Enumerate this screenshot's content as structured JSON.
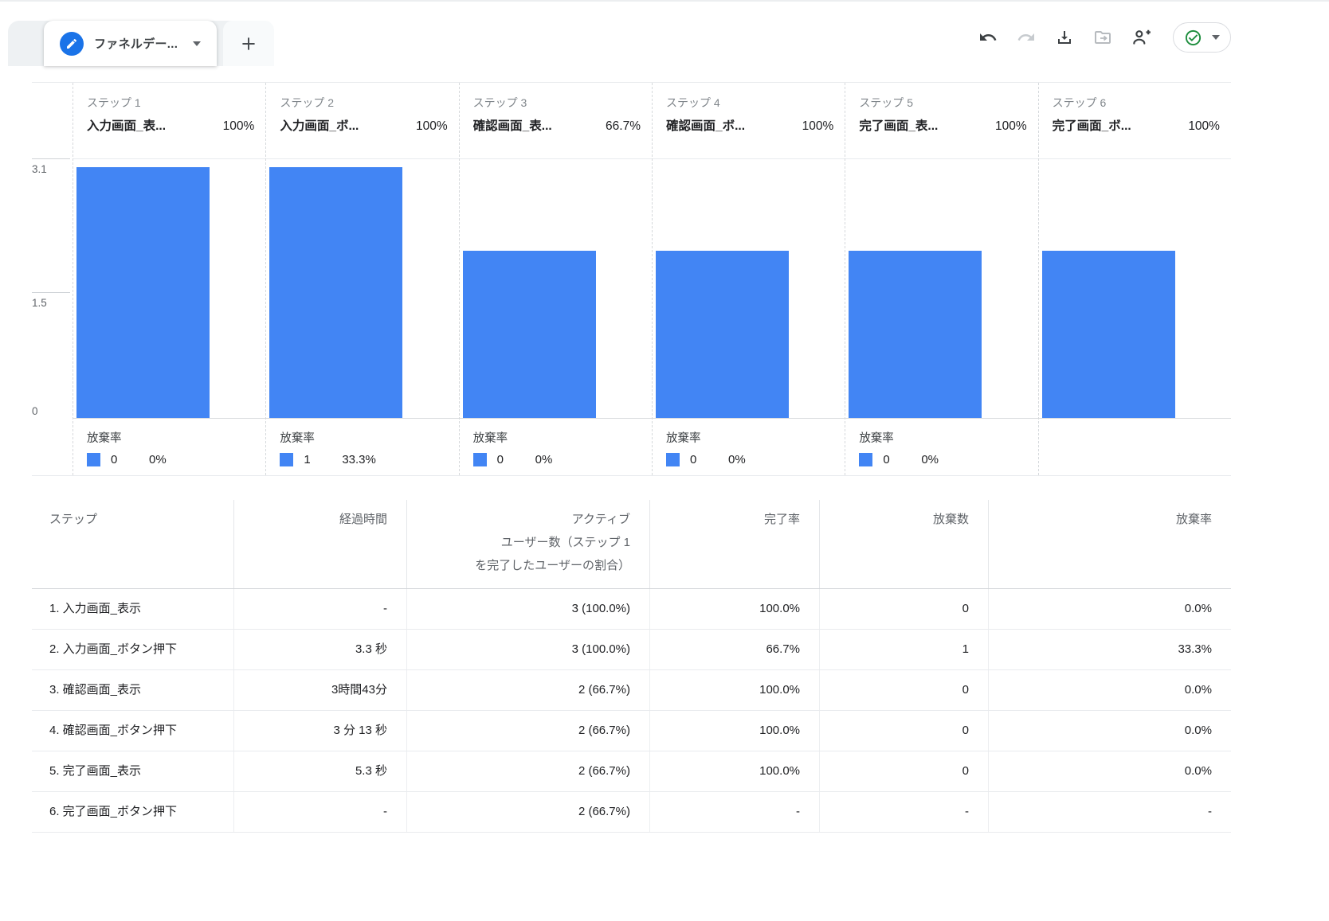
{
  "tab_bar": {
    "active_tab": "ファネルデー..."
  },
  "toolbar": {
    "icons": [
      "undo-icon",
      "redo-icon",
      "download-icon",
      "export-folder-icon",
      "person-add-icon",
      "check-circle-icon",
      "chevron-down-icon"
    ],
    "status_color": "#1e8e3e"
  },
  "chart_data": {
    "type": "bar",
    "title": "",
    "xlabel": "",
    "ylabel": "",
    "ylim": [
      0,
      3.1
    ],
    "y_ticks": [
      "3.1",
      "1.5",
      "0"
    ],
    "bar_color": "#4285f4",
    "abandon_label": "放棄率",
    "categories": [
      "入力画面_表...",
      "入力画面_ボ...",
      "確認画面_表...",
      "確認画面_ボ...",
      "完了画面_表...",
      "完了画面_ボ..."
    ],
    "values": [
      3,
      3,
      2,
      2,
      2,
      2
    ],
    "steps": [
      {
        "label": "ステップ 1",
        "name": "入力画面_表...",
        "completion": "100%",
        "value": 3,
        "abandonments": "0",
        "abandonment_rate": "0%",
        "show_abandon": true
      },
      {
        "label": "ステップ 2",
        "name": "入力画面_ボ...",
        "completion": "100%",
        "value": 3,
        "abandonments": "1",
        "abandonment_rate": "33.3%",
        "show_abandon": true
      },
      {
        "label": "ステップ 3",
        "name": "確認画面_表...",
        "completion": "66.7%",
        "value": 2,
        "abandonments": "0",
        "abandonment_rate": "0%",
        "show_abandon": true
      },
      {
        "label": "ステップ 4",
        "name": "確認画面_ボ...",
        "completion": "100%",
        "value": 2,
        "abandonments": "0",
        "abandonment_rate": "0%",
        "show_abandon": true
      },
      {
        "label": "ステップ 5",
        "name": "完了画面_表...",
        "completion": "100%",
        "value": 2,
        "abandonments": "0",
        "abandonment_rate": "0%",
        "show_abandon": true
      },
      {
        "label": "ステップ 6",
        "name": "完了画面_ボ...",
        "completion": "100%",
        "value": 2,
        "abandonments": "",
        "abandonment_rate": "",
        "show_abandon": false
      }
    ]
  },
  "table": {
    "columns": [
      "ステップ",
      "経過時間",
      "アクティブ\nユーザー数（ステップ 1\nを完了したユーザーの割合）",
      "完了率",
      "放棄数",
      "放棄率"
    ],
    "rows": [
      [
        "1. 入力画面_表示",
        "-",
        "3 (100.0%)",
        "100.0%",
        "0",
        "0.0%"
      ],
      [
        "2. 入力画面_ボタン押下",
        "3.3 秒",
        "3 (100.0%)",
        "66.7%",
        "1",
        "33.3%"
      ],
      [
        "3. 確認画面_表示",
        "3時間43分",
        "2 (66.7%)",
        "100.0%",
        "0",
        "0.0%"
      ],
      [
        "4. 確認画面_ボタン押下",
        "3 分 13 秒",
        "2 (66.7%)",
        "100.0%",
        "0",
        "0.0%"
      ],
      [
        "5. 完了画面_表示",
        "5.3 秒",
        "2 (66.7%)",
        "100.0%",
        "0",
        "0.0%"
      ],
      [
        "6. 完了画面_ボタン押下",
        "-",
        "2 (66.7%)",
        "-",
        "-",
        "-"
      ]
    ]
  }
}
